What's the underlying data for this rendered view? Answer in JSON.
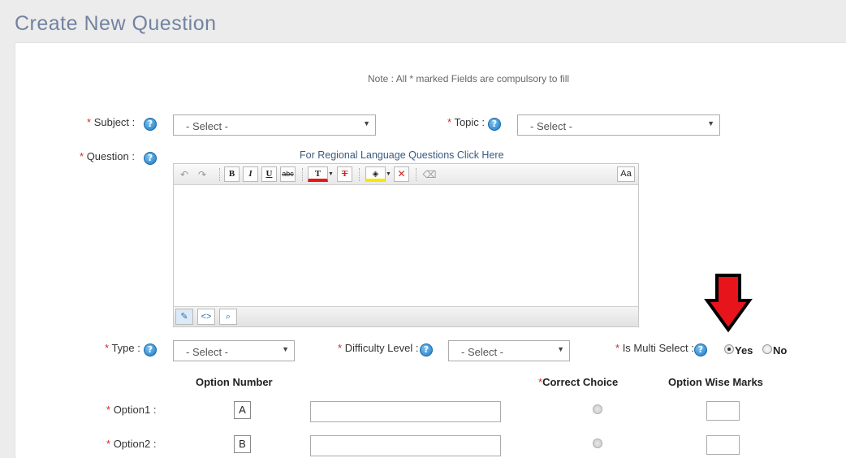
{
  "page": {
    "title": "Create New Question"
  },
  "form": {
    "note": "Note : All * marked Fields are compulsory to fill",
    "required_mark": "*",
    "subject": {
      "label": "Subject :",
      "value": "- Select -"
    },
    "topic": {
      "label": "Topic :",
      "value": "- Select -"
    },
    "question": {
      "label": "Question :",
      "regional_link": "For Regional Language Questions Click Here"
    },
    "type": {
      "label": "Type :",
      "value": "- Select -"
    },
    "difficulty": {
      "label": "Difficulty Level :",
      "value": "- Select -"
    },
    "multi_select": {
      "label": "Is Multi Select :",
      "yes": "Yes",
      "no": "No",
      "selected": "Yes"
    },
    "options_header": {
      "option_number": "Option Number",
      "correct_choice": "Correct Choice",
      "option_marks": "Option Wise Marks"
    },
    "options": [
      {
        "label": "Option1 :",
        "letter": "A"
      },
      {
        "label": "Option2 :",
        "letter": "B"
      }
    ]
  },
  "editor": {
    "toolbar": {
      "undo": "↶",
      "redo": "↷",
      "bold": "B",
      "italic": "I",
      "underline": "U",
      "strike": "abc",
      "font_color": "T",
      "clear_format": "T",
      "case": "Aa"
    },
    "icons": [
      "undo-icon",
      "redo-icon",
      "bold-icon",
      "italic-icon",
      "underline-icon",
      "strikethrough-icon",
      "font-color-icon",
      "remove-format-icon",
      "highlight-icon",
      "remove-highlight-icon",
      "eraser-icon",
      "case-icon",
      "design-mode-icon",
      "html-mode-icon",
      "preview-icon"
    ]
  },
  "colors": {
    "title": "#7283a0",
    "required": "#d02a2a",
    "arrow": "#e8141b",
    "help": "#1a78c2"
  }
}
